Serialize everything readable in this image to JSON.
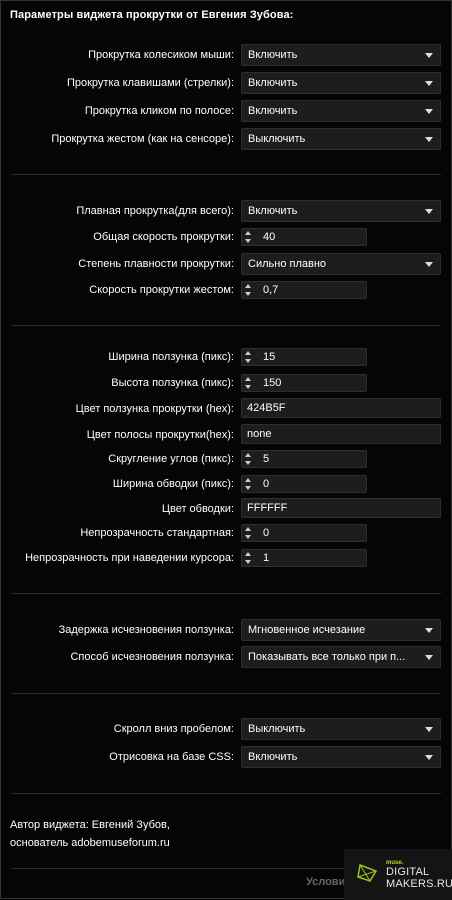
{
  "title": "Параметры виджета прокрутки от Евгения Зубова:",
  "sections": {
    "wheel": {
      "label": "Прокрутка колесиком мыши:",
      "value": "Включить"
    },
    "keys": {
      "label": "Прокрутка клавишами (стрелки):",
      "value": "Включить"
    },
    "bar_click": {
      "label": "Прокрутка кликом по полосе:",
      "value": "Включить"
    },
    "gesture": {
      "label": "Прокрутка жестом (как на сенсоре):",
      "value": "Выключить"
    },
    "smooth": {
      "label": "Плавная прокрутка(для всего):",
      "value": "Включить"
    },
    "speed": {
      "label": "Общая скорость прокрутки:",
      "value": "40"
    },
    "smoothness": {
      "label": "Степень плавности прокрутки:",
      "value": "Сильно плавно"
    },
    "gesture_speed": {
      "label": "Скорость прокрутки жестом:",
      "value": "0,7"
    },
    "thumb_width": {
      "label": "Ширина ползунка (пикс):",
      "value": "15"
    },
    "thumb_height": {
      "label": "Высота ползунка (пикс):",
      "value": "150"
    },
    "thumb_color": {
      "label": "Цвет ползунка прокрутки (hex):",
      "value": "424B5F"
    },
    "track_color": {
      "label": "Цвет полосы прокрутки(hex):",
      "value": "none"
    },
    "radius": {
      "label": "Скругление углов (пикс):",
      "value": "5"
    },
    "border_width": {
      "label": "Ширина обводки (пикс):",
      "value": "0"
    },
    "border_color": {
      "label": "Цвет обводки:",
      "value": "FFFFFF"
    },
    "opacity": {
      "label": "Непрозрачность стандартная:",
      "value": "0"
    },
    "opacity_hover": {
      "label": "Непрозрачность при наведении курсора:",
      "value": "1"
    },
    "hide_delay": {
      "label": "Задержка исчезновения ползунка:",
      "value": "Мгновенное исчезание"
    },
    "hide_mode": {
      "label": "Способ исчезновения ползунка:",
      "value": "Показывать все только при п..."
    },
    "space_scroll": {
      "label": "Скролл вниз пробелом:",
      "value": "Выключить"
    },
    "css_render": {
      "label": "Отрисовка на базе CSS:",
      "value": "Включить"
    }
  },
  "author": {
    "line1": "Автор виджета: Евгений Зубов,",
    "line2": "основатель adobemuseforum.ru"
  },
  "footer": {
    "text": "Услови"
  },
  "brand": {
    "small": "muse.",
    "line1": "DIGITAL",
    "line2": "MAKERS.RU",
    "accent": "#b6d327"
  }
}
